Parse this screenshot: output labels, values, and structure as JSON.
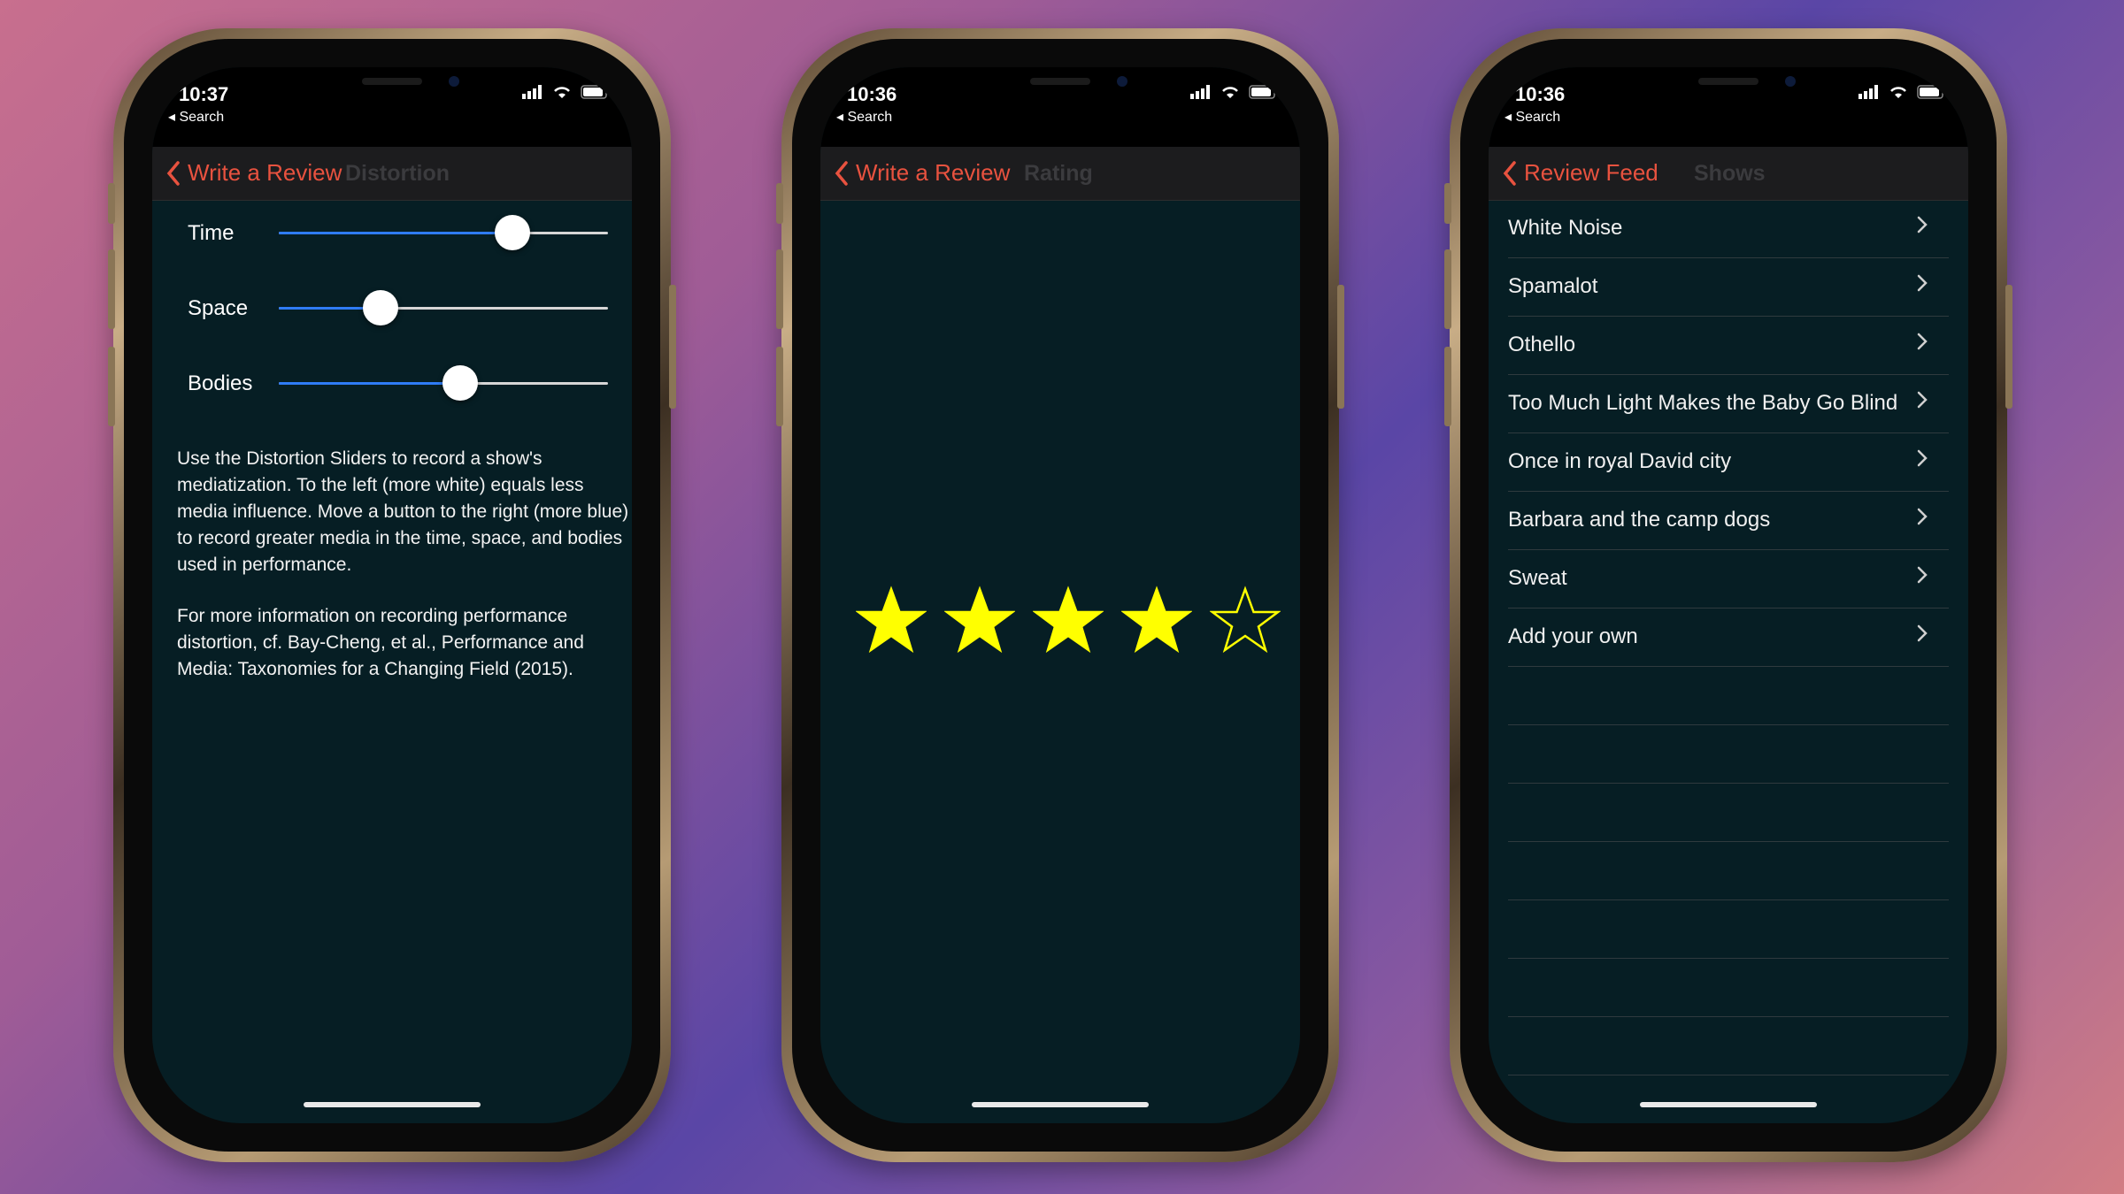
{
  "phones": [
    {
      "status": {
        "time": "10:37",
        "back_app": "◂ Search"
      },
      "nav": {
        "back_label": "Write a Review",
        "title": "Distortion"
      },
      "sliders": [
        {
          "label": "Time",
          "value": 0.71
        },
        {
          "label": "Space",
          "value": 0.31
        },
        {
          "label": "Bodies",
          "value": 0.55
        }
      ],
      "paragraphs": [
        "Use the Distortion Sliders to record a show's mediatization. To the left (more white) equals less media influence. Move a button to the right (more blue) to record greater media in the time, space, and bodies used in performance.",
        "For more information on recording performance distortion, cf. Bay-Cheng, et al., Performance and Media: Taxonomies for a Changing Field (2015)."
      ]
    },
    {
      "status": {
        "time": "10:36",
        "back_app": "◂ Search"
      },
      "nav": {
        "back_label": "Write a Review",
        "title": "Rating"
      },
      "rating": {
        "value": 4,
        "max": 5,
        "color": "#ffff00"
      }
    },
    {
      "status": {
        "time": "10:36",
        "back_app": "◂ Search"
      },
      "nav": {
        "back_label": "Review Feed",
        "title": "Shows"
      },
      "shows": [
        "White Noise",
        "Spamalot",
        "Othello",
        "Too Much Light Makes the Baby Go Blind",
        "Once in royal David city",
        "Barbara and the camp dogs",
        "Sweat",
        "Add your own"
      ]
    }
  ],
  "colors": {
    "accent": "#e8523f",
    "screen_bg": "#061e24",
    "slider_fill": "#2f7cf6"
  }
}
